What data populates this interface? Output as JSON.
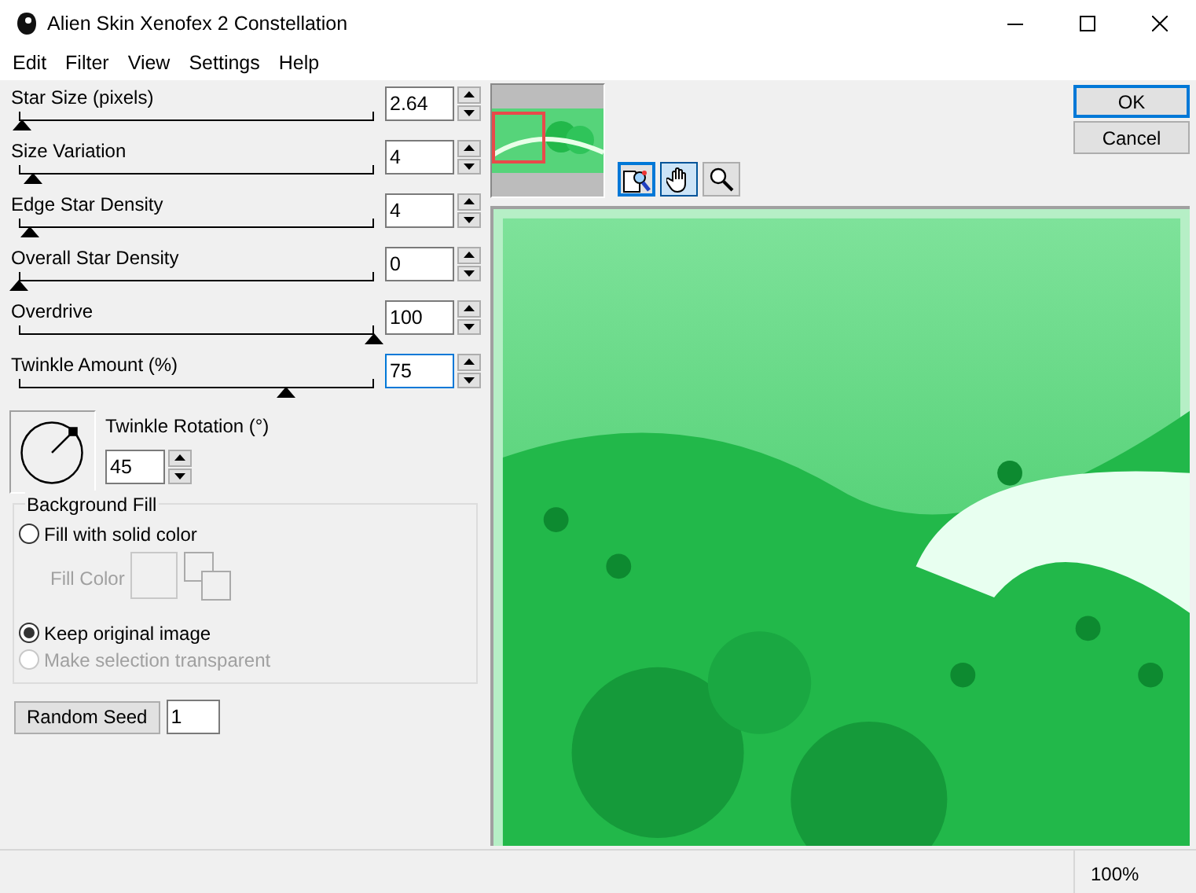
{
  "window": {
    "title": "Alien Skin Xenofex 2 Constellation"
  },
  "menu": [
    "Edit",
    "Filter",
    "View",
    "Settings",
    "Help"
  ],
  "sliders": [
    {
      "label": "Star Size (pixels)",
      "value": "2.64",
      "level": 0.01,
      "focused": false
    },
    {
      "label": "Size Variation",
      "value": "4",
      "level": 0.04,
      "focused": false
    },
    {
      "label": "Edge Star Density",
      "value": "4",
      "level": 0.03,
      "focused": false
    },
    {
      "label": "Overall Star Density",
      "value": "0",
      "level": 0,
      "focused": false
    },
    {
      "label": "Overdrive",
      "value": "100",
      "level": 1,
      "focused": false
    },
    {
      "label": "Twinkle Amount (%)",
      "value": "75",
      "level": 0.75,
      "focused": true
    }
  ],
  "rotation": {
    "label": "Twinkle Rotation (°)",
    "value": "45"
  },
  "background_fill": {
    "title": "Background Fill",
    "options": [
      {
        "label": "Fill with solid color",
        "selected": false,
        "disabled": false
      },
      {
        "label": "Keep original image",
        "selected": true,
        "disabled": false
      },
      {
        "label": "Make selection transparent",
        "selected": false,
        "disabled": true
      }
    ],
    "fill_color": {
      "label": "Fill Color",
      "disabled": true
    }
  },
  "random_seed": {
    "button": "Random Seed",
    "value": "1"
  },
  "tools": [
    {
      "kind": "pan-zoom",
      "focused": true,
      "selected": false
    },
    {
      "kind": "hand",
      "focused": false,
      "selected": true
    },
    {
      "kind": "zoom",
      "focused": false,
      "selected": false
    }
  ],
  "buttons": [
    {
      "label": "OK",
      "default": true
    },
    {
      "label": "Cancel",
      "default": false
    }
  ],
  "status_bar": {
    "zoom": "100%"
  }
}
